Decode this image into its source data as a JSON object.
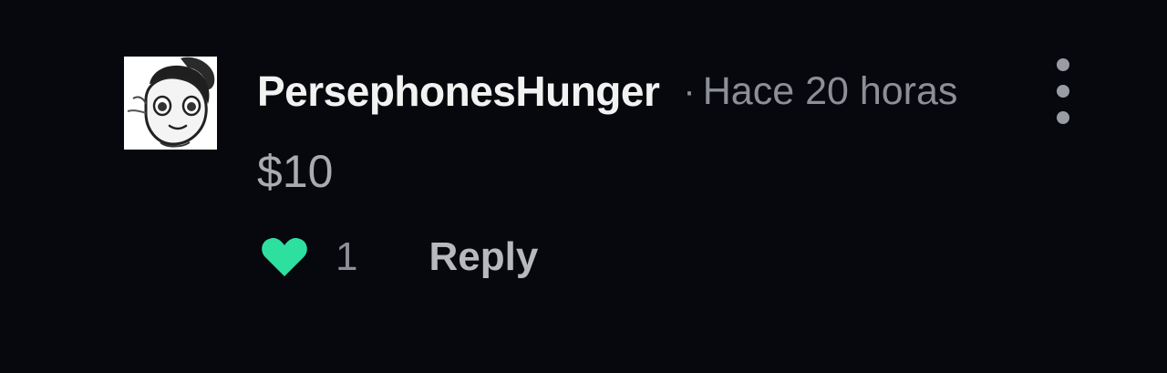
{
  "comment": {
    "username": "PersephonesHunger",
    "separator": "·",
    "timestamp": "Hace 20 horas",
    "body": "$10",
    "likes": "1",
    "reply_label": "Reply",
    "like_icon": "heart-icon",
    "like_color": "#2ee0a0",
    "more_icon": "vertical-dots-icon"
  }
}
